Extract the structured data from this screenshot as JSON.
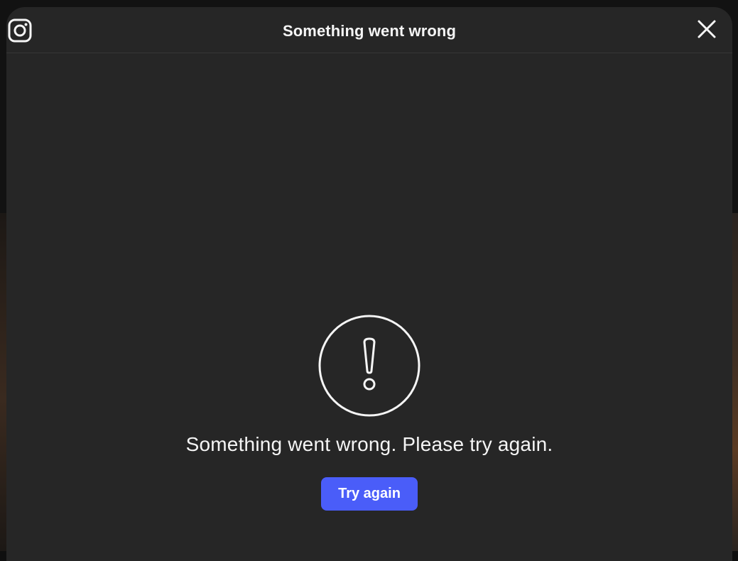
{
  "header": {
    "logo_icon": "instagram-icon",
    "title": "Something went wrong",
    "close_icon": "close-icon"
  },
  "error": {
    "icon": "exclamation-circle-icon",
    "message": "Something went wrong. Please try again.",
    "button_label": "Try again"
  },
  "colors": {
    "modal_background": "#262626",
    "button_background": "#4a5df9",
    "text": "#f5f5f5"
  }
}
